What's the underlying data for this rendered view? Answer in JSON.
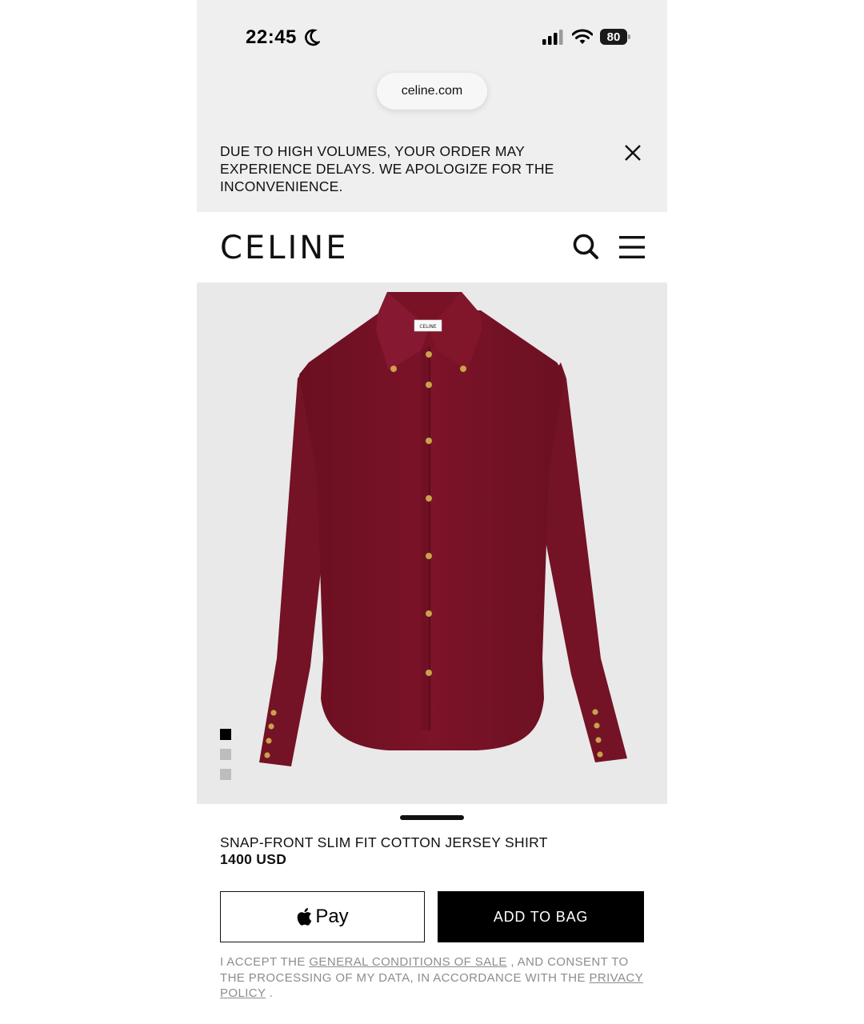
{
  "status_bar": {
    "time": "22:45",
    "battery": "80"
  },
  "browser": {
    "url": "celine.com"
  },
  "banner": {
    "message": "DUE TO HIGH VOLUMES, YOUR ORDER MAY EXPERIENCE DELAYS. WE APOLOGIZE FOR THE INCONVENIENCE."
  },
  "header": {
    "logo": "CELINE"
  },
  "product": {
    "name": "SNAP-FRONT SLIM FIT COTTON JERSEY SHIRT",
    "price": "1400 USD",
    "label_text": "CELINE",
    "image_count": 3,
    "active_image": 1,
    "color": "#7a1226"
  },
  "actions": {
    "apple_pay": "Pay",
    "add_to_bag": "ADD TO BAG"
  },
  "legal": {
    "prefix": "I ACCEPT THE",
    "conditions_link": "GENERAL CONDITIONS OF SALE",
    "middle": ", AND CONSENT TO THE PROCESSING OF MY DATA, IN ACCORDANCE WITH THE",
    "privacy_link": "PRIVACY POLICY",
    "suffix": "."
  },
  "icons": [
    "moon-icon",
    "signal-icon",
    "wifi-icon",
    "battery-icon",
    "close-icon",
    "search-icon",
    "menu-icon",
    "apple-logo-icon"
  ]
}
